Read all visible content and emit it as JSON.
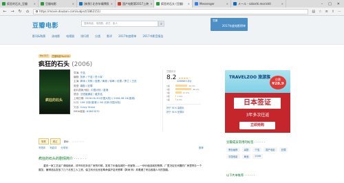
{
  "browser": {
    "tabs": [
      {
        "label": "疯狂的石头_豆瓣",
        "color": "#2e963d",
        "active": false
      },
      {
        "label": "豆瓣电影",
        "color": "#2e963d",
        "active": false
      },
      {
        "label": "[新鲜] 北京车辆牌照",
        "color": "#1f6fb5",
        "active": false
      },
      {
        "label": "国产电影第2017上映",
        "color": "#d23a2f",
        "active": false
      },
      {
        "label": "疯狂的石头 (豆瓣)",
        "color": "#2e963d",
        "active": true
      },
      {
        "label": "Messenger",
        "color": "#2d7ff9",
        "active": false
      },
      {
        "label": "メール - satoshi.morishit",
        "color": "#1565c0",
        "active": false
      }
    ],
    "url": "https://movie.douban.com/subject/1862151/"
  },
  "site": {
    "logo": "豆瓣电影",
    "search_placeholder": "搜索电影、电视剧、综艺、影人",
    "nav": [
      "影讯&购票",
      "选电影",
      "电视剧",
      "排行榜",
      "分类",
      "影评",
      "2017年度榜单",
      "2017书影音报告"
    ],
    "promo_line1": "豆瓣",
    "promo_line2": "2017年度电影榜单"
  },
  "movie": {
    "rank_badge": "No.217",
    "rank_list": "豆瓣电影Top250",
    "title": "疯狂的石头",
    "year": "(2006)",
    "poster_text": "疯狂的石头",
    "info": [
      {
        "k": "导演:",
        "v": "宁浩"
      },
      {
        "k": "编剧:",
        "v": "张承 / 宁浩 / 岳小军"
      },
      {
        "k": "主演:",
        "v": "郭涛 / 刘桦 / 连晋 / 黄渤 / 徐峥 / 优恵 / 罗兰 / 王迅"
      },
      {
        "k": "类型:",
        "v": "喜剧 / 犯罪"
      },
      {
        "k": "制片国家/地区:",
        "v": "中国大陆 / 香港"
      },
      {
        "k": "语言:",
        "v": "汉语普通话 / 重庆话"
      },
      {
        "k": "上映日期:",
        "v": "2006-06-30(中国大陆) / 2006-08-18(香港)"
      },
      {
        "k": "片长:",
        "v": "106 分钟(香港) / 98 分钟(中国大陆)"
      },
      {
        "k": "又名:",
        "v": "Crazy Stone"
      },
      {
        "k": "IMDb链接:",
        "v": "tt0843270"
      }
    ]
  },
  "rating": {
    "label": "豆瓣评分",
    "score": "8.2",
    "count": "426666人评价",
    "rows": [
      {
        "label": "5星",
        "pct": 34.3,
        "pct_text": "34.3%"
      },
      {
        "label": "4星",
        "pct": 46.2,
        "pct_text": "46.2%"
      },
      {
        "label": "3星",
        "pct": 17.4,
        "pct_text": "17.4%"
      },
      {
        "label": "2星",
        "pct": 1.6,
        "pct_text": "1.6%"
      },
      {
        "label": "1星",
        "pct": 0.5,
        "pct_text": "0.5%"
      }
    ],
    "better1": "好于 91% 喜剧片",
    "better2": "好于 91% 犯罪片"
  },
  "ad": {
    "brand": "TRAVELZOO 旅游族",
    "price_label": "仅需",
    "price": "¥28.9",
    "headline": "日本签证",
    "sub": "3年多次往返",
    "cta": "立即抢购"
  },
  "actions": {
    "want": "想看",
    "seen": "看过",
    "my_rating": "评价:",
    "write_short": "写短评",
    "write_review": "写影评",
    "share": "分享到",
    "recommend": "推荐"
  },
  "synopsis": {
    "heading": "疯狂的石头的剧情简介 · · · · · ·",
    "text": "　　重庆一家工艺品厂濒临倒闭，却不料在拆旧厂房的时候，发现了价值连城的一块宝物——一块价值连城的翡翠。厂里决定在闲置的厂房里举办一个展览，赚得钱后发放了几个月的工人工资。保卫科长包世宏奉命保护这块翡翠（郭涛 饰）却遭遇了来自各路人马的觊觎。"
  },
  "sidebar": {
    "tags_heading": "豆瓣成员常用的标签 · · · · · ·",
    "tags": [
      "黑色幽默",
      "喜剧",
      "宁浩",
      "国产电影",
      "犯罪",
      "中国电影",
      "黄渤",
      "2006"
    ],
    "next_heading": "以下片单推荐 · · · · · ·"
  }
}
